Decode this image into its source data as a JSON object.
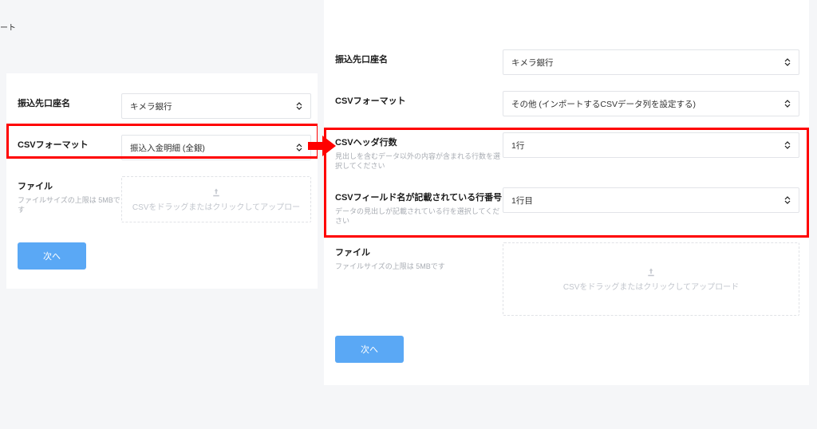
{
  "left": {
    "sliver": "ート",
    "account_label": "振込先口座名",
    "account_value": "キメラ銀行",
    "format_label": "CSVフォーマット",
    "format_value": "振込入金明細 (全銀)",
    "file_label": "ファイル",
    "file_sub": "ファイルサイズの上限は 5MBです",
    "drop_text": "CSVをドラッグまたはクリックしてアップロー",
    "next": "次へ"
  },
  "right": {
    "account_label": "振込先口座名",
    "account_value": "キメラ銀行",
    "format_label": "CSVフォーマット",
    "format_value": "その他 (インポートするCSVデータ列を設定する)",
    "header_rows_label": "CSVヘッダ行数",
    "header_rows_sub": "見出しを含むデータ以外の内容が含まれる行数を選択してください",
    "header_rows_value": "1行",
    "fieldname_row_label": "CSVフィールド名が記載されている行番号",
    "fieldname_row_sub": "データの見出しが記載されている行を選択してください",
    "fieldname_row_value": "1行目",
    "file_label": "ファイル",
    "file_sub": "ファイルサイズの上限は 5MBです",
    "drop_text": "CSVをドラッグまたはクリックしてアップロード",
    "next": "次へ"
  }
}
